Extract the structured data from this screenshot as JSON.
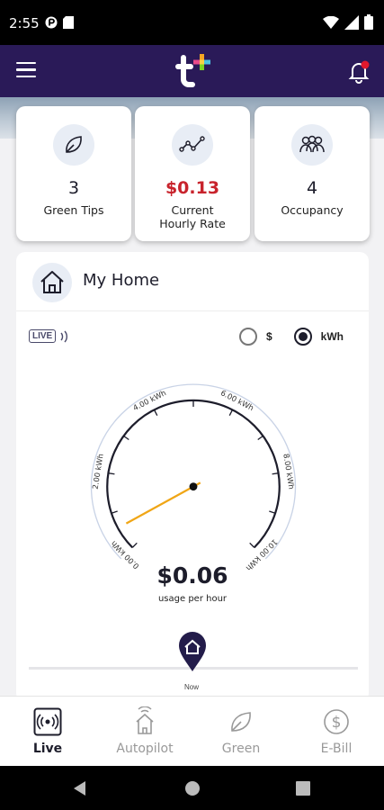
{
  "status": {
    "time": "2:55"
  },
  "stats": [
    {
      "value": "3",
      "label": "Green Tips",
      "icon": "leaf-icon"
    },
    {
      "value": "$0.13",
      "label1": "Current",
      "label2": "Hourly Rate",
      "icon": "trend-line-icon"
    },
    {
      "value": "4",
      "label": "Occupancy",
      "icon": "people-icon"
    }
  ],
  "home": {
    "title": "My Home",
    "live_label": "LIVE",
    "radio": {
      "dollar": "$",
      "kwh": "kWh",
      "selected": "kWh"
    },
    "gauge": {
      "ticks": [
        "0.00 kWh",
        "2.00 kWh",
        "4.00 kWh",
        "6.00 kWh",
        "8.00 kWh",
        "10.00 kWh"
      ],
      "min": 0,
      "max": 10,
      "current_kwh": 0.6
    },
    "usage_value": "$0.06",
    "usage_label": "usage per hour",
    "now_label": "Now"
  },
  "nav": [
    {
      "label": "Live",
      "icon": "live-broadcast-icon",
      "active": true
    },
    {
      "label": "Autopilot",
      "icon": "autopilot-home-icon",
      "active": false
    },
    {
      "label": "Green",
      "icon": "leaf-icon",
      "active": false
    },
    {
      "label": "E-Bill",
      "icon": "dollar-circle-icon",
      "active": false
    }
  ],
  "colors": {
    "header": "#2a1a58",
    "accent_red": "#c8232c",
    "needle": "#f0a616",
    "dial": "#1d1d2b"
  }
}
